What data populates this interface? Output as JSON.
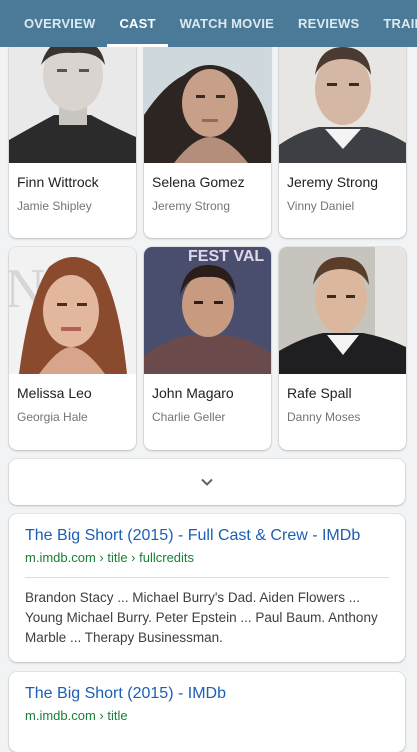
{
  "tabs": [
    {
      "label": "OVERVIEW"
    },
    {
      "label": "CAST"
    },
    {
      "label": "WATCH MOVIE"
    },
    {
      "label": "REVIEWS"
    },
    {
      "label": "TRAILERS"
    }
  ],
  "active_tab": "CAST",
  "cast": [
    {
      "actor": "Finn Wittrock",
      "role": "Jamie Shipley"
    },
    {
      "actor": "Selena Gomez",
      "role": "Jeremy Strong"
    },
    {
      "actor": "Jeremy Strong",
      "role": "Vinny Daniel"
    },
    {
      "actor": "Melissa Leo",
      "role": "Georgia Hale"
    },
    {
      "actor": "John Magaro",
      "role": "Charlie Geller"
    },
    {
      "actor": "Rafe Spall",
      "role": "Danny Moses"
    }
  ],
  "expand": {
    "icon": "chevron-down-icon"
  },
  "results": [
    {
      "title": "The Big Short (2015) - Full Cast & Crew - IMDb",
      "url": "m.imdb.com › title › fullcredits",
      "snippet": "Brandon Stacy ... Michael Burry's Dad. Aiden Flowers ... Young Michael Burry. Peter Epstein ... Paul Baum. Anthony Marble ... Therapy Businessman."
    },
    {
      "title": "The Big Short (2015) - IMDb",
      "url": "m.imdb.com › title"
    }
  ],
  "colors": {
    "tabbar": "#4b7a99",
    "link": "#1a5fb4",
    "url_green": "#188038"
  }
}
